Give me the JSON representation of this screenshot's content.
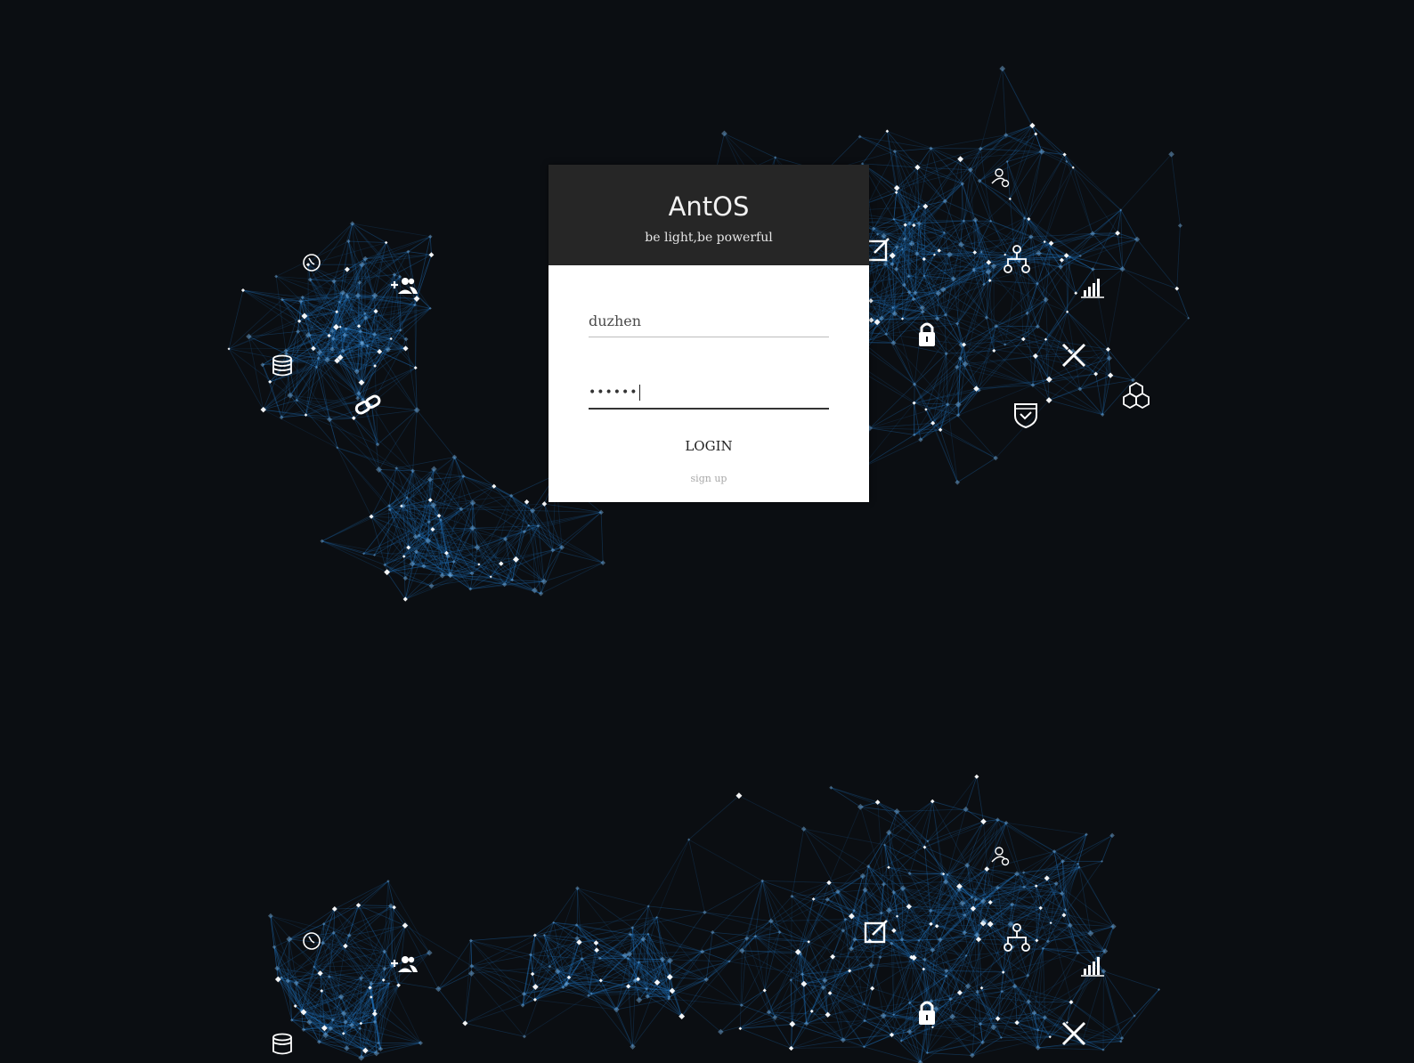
{
  "app": {
    "title": "AntOS",
    "tagline": "be light,be powerful"
  },
  "login": {
    "username_value": "duzhen",
    "password_mask": "••••••",
    "login_label": "LOGIN",
    "signup_label": "sign up"
  },
  "background": {
    "icons": [
      "timer-icon",
      "add-user-icon",
      "database-icon",
      "link-icon",
      "edit-icon",
      "user-settings-icon",
      "hierarchy-icon",
      "chart-icon",
      "lock-icon",
      "tools-icon",
      "cubes-icon",
      "shield-icon"
    ]
  },
  "colors": {
    "background": "#0b0e12",
    "network_line": "#1f6fb8",
    "header": "#262626",
    "panel": "#ffffff"
  }
}
